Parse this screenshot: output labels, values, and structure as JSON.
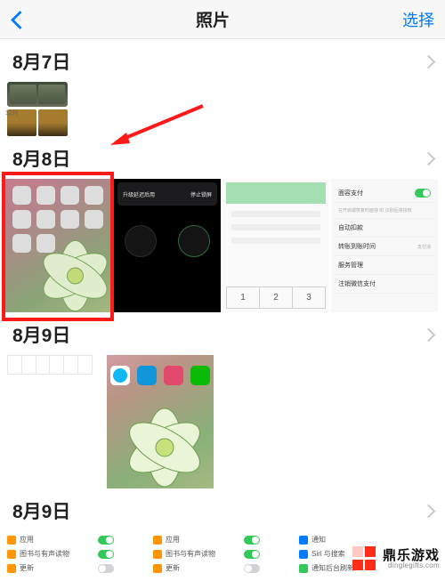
{
  "header": {
    "title": "照片",
    "select": "选择"
  },
  "sections": [
    {
      "title": "8月7日",
      "thumb_caption": "12月"
    },
    {
      "title": "8月8日",
      "t2": {
        "bar_left": "升级延迟后用",
        "bar_right": "停止锁屏"
      },
      "t3": {
        "cells": [
          "1",
          "2",
          "3"
        ]
      },
      "t4": {
        "r1_label": "面容支付",
        "r1_sub": "在开启或恢复时面容 ID 识别后将授权",
        "r2_label": "自动扣款",
        "r3_label": "转账到账时间",
        "r3_right": "支付消",
        "r4_label": "服务管理",
        "r5_label": "注销微信支付"
      }
    },
    {
      "title": "8月9日"
    },
    {
      "title": "8月9日",
      "colA": {
        "l1": "应用",
        "l2": "图书与有声读物",
        "l3": "更新"
      },
      "colB": {
        "l1": "应用",
        "l2": "图书与有声读物",
        "l3": "更新"
      },
      "colC": {
        "l1": "通知",
        "l2": "Siri 与搜索",
        "l3": "通知后台刷新"
      }
    }
  ],
  "watermark": {
    "cn": "鼎乐游戏",
    "en": "dinglegifts.com"
  }
}
